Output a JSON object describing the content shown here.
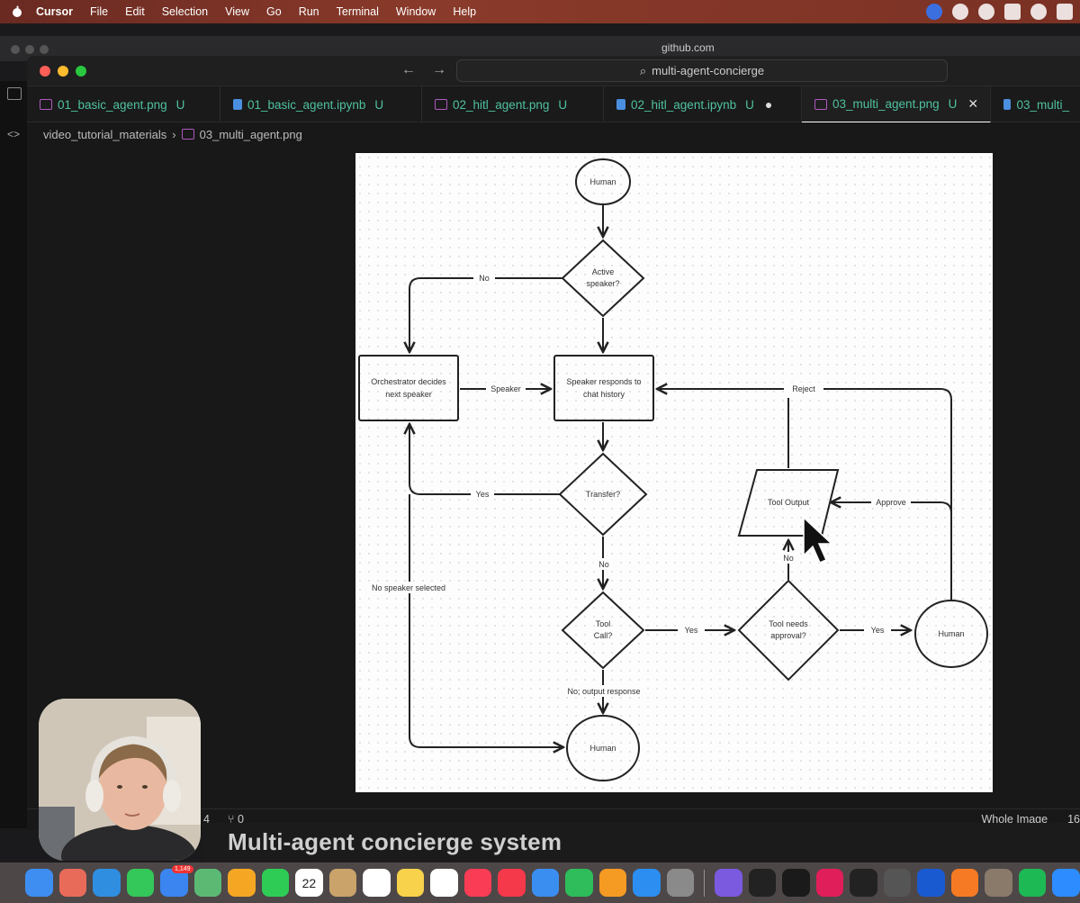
{
  "menubar": {
    "items": [
      "Cursor",
      "File",
      "Edit",
      "Selection",
      "View",
      "Go",
      "Run",
      "Terminal",
      "Window",
      "Help"
    ]
  },
  "browser": {
    "url": "github.com"
  },
  "editor": {
    "command_center": "multi-agent-concierge",
    "tabs": [
      {
        "label": "01_basic_agent.png",
        "status": "U",
        "kind": "image"
      },
      {
        "label": "01_basic_agent.ipynb",
        "status": "U",
        "kind": "notebook"
      },
      {
        "label": "02_hitl_agent.png",
        "status": "U",
        "kind": "image"
      },
      {
        "label": "02_hitl_agent.ipynb",
        "status": "U",
        "kind": "notebook",
        "modified": true
      },
      {
        "label": "03_multi_agent.png",
        "status": "U",
        "kind": "image",
        "active": true
      },
      {
        "label": "03_multi_",
        "status": "",
        "kind": "notebook"
      }
    ],
    "breadcrumb": {
      "folder": "video_tutorial_materials",
      "file": "03_multi_agent.png"
    },
    "status": {
      "left_a": "4",
      "left_b": "0",
      "zoom_label": "Whole Image",
      "right_partial": "16"
    }
  },
  "diagram": {
    "human_top": "Human",
    "active_speaker": [
      "Active",
      "speaker?"
    ],
    "no_label_1": "No",
    "orchestrator": [
      "Orchestrator decides",
      "next speaker"
    ],
    "speaker_label": "Speaker",
    "speaker_responds": [
      "Speaker responds to",
      "chat history"
    ],
    "reject_label": "Reject",
    "transfer": "Transfer?",
    "yes_label_1": "Yes",
    "tool_output": "Tool Output",
    "approve_label": "Approve",
    "no_label_2": "No",
    "no_label_3": "No",
    "no_speaker_selected": "No speaker selected",
    "tool_call": [
      "Tool",
      "Call?"
    ],
    "yes_label_2": "Yes",
    "tool_needs_approval": [
      "Tool needs",
      "approval?"
    ],
    "yes_label_3": "Yes",
    "human_right": "Human",
    "no_output_response": "No; output response",
    "human_bottom": "Human"
  },
  "caption": "Multi-agent concierge system",
  "dock": {
    "apps": [
      {
        "name": "finder",
        "color": "#3d8ef0"
      },
      {
        "name": "launchpad",
        "color": "#e86b5a"
      },
      {
        "name": "safari",
        "color": "#2f8ee0"
      },
      {
        "name": "messages",
        "color": "#34c759"
      },
      {
        "name": "mail",
        "color": "#3a85f0",
        "badge": "1,149"
      },
      {
        "name": "maps",
        "color": "#5bb974"
      },
      {
        "name": "photos",
        "color": "#f5a623"
      },
      {
        "name": "facetime",
        "color": "#2ecc55"
      },
      {
        "name": "calendar",
        "color": "#ffffff",
        "text": "22"
      },
      {
        "name": "contacts",
        "color": "#c9a36a"
      },
      {
        "name": "reminders",
        "color": "#ffffff"
      },
      {
        "name": "notes",
        "color": "#f7d24a"
      },
      {
        "name": "freeform",
        "color": "#ffffff"
      },
      {
        "name": "music",
        "color": "#fa3c55"
      },
      {
        "name": "news",
        "color": "#f5384a"
      },
      {
        "name": "keynote",
        "color": "#3a8ef0"
      },
      {
        "name": "numbers",
        "color": "#2ebd5a"
      },
      {
        "name": "pages",
        "color": "#f59a23"
      },
      {
        "name": "app-store",
        "color": "#2b8ef0"
      },
      {
        "name": "system-settings",
        "color": "#8a8a8a"
      },
      {
        "name": "obsidian",
        "color": "#7b5ae0"
      },
      {
        "name": "activity-monitor",
        "color": "#222222"
      },
      {
        "name": "terminal",
        "color": "#1a1a1a"
      },
      {
        "name": "slack",
        "color": "#e01e5a"
      },
      {
        "name": "cursor",
        "color": "#222222"
      },
      {
        "name": "calculator",
        "color": "#555555"
      },
      {
        "name": "1password",
        "color": "#1a5ad0"
      },
      {
        "name": "sublime",
        "color": "#f57a23"
      },
      {
        "name": "tableplus",
        "color": "#8a7a6a"
      },
      {
        "name": "spotify",
        "color": "#1db954"
      },
      {
        "name": "zoom",
        "color": "#2d8cff"
      }
    ]
  }
}
